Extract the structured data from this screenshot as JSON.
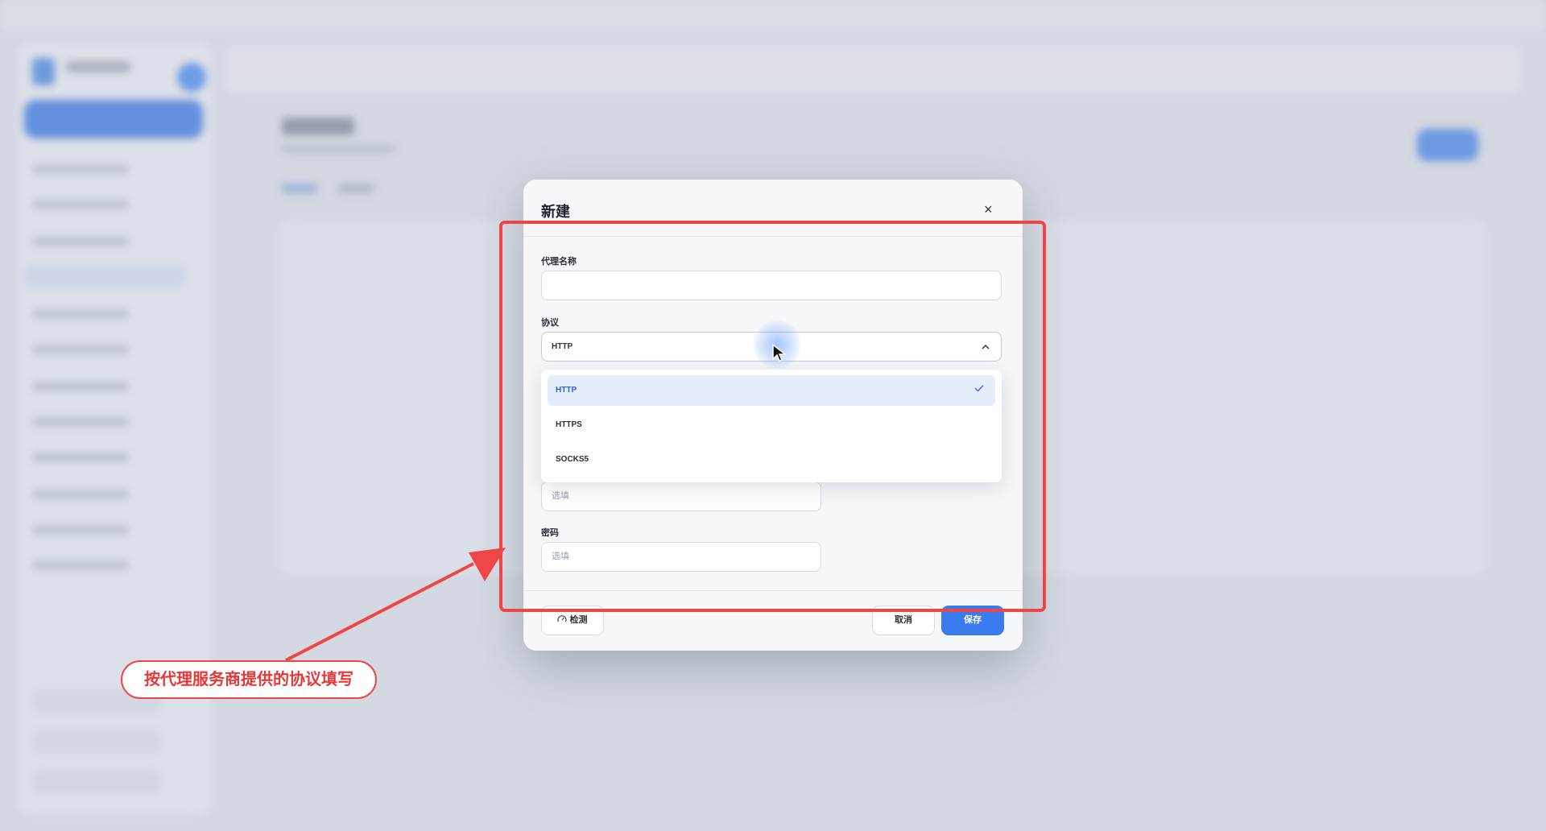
{
  "modal": {
    "title": "新建",
    "close_glyph": "×",
    "fields": {
      "proxy_name_label": "代理名称",
      "proxy_name_value": "",
      "protocol_label": "协议",
      "protocol_value": "HTTP",
      "username_placeholder": "选填",
      "password_label": "密码",
      "password_placeholder": "选填"
    },
    "dropdown": {
      "options": [
        "HTTP",
        "HTTPS",
        "SOCKS5"
      ],
      "selected": "HTTP"
    },
    "buttons": {
      "detect": "检测",
      "cancel": "取消",
      "save": "保存"
    }
  },
  "annotation": {
    "callout_text": "按代理服务商提供的协议填写",
    "color": "#ee4646"
  },
  "colors": {
    "primary": "#3a7cf0",
    "selected_option_bg": "#e7eefb"
  }
}
